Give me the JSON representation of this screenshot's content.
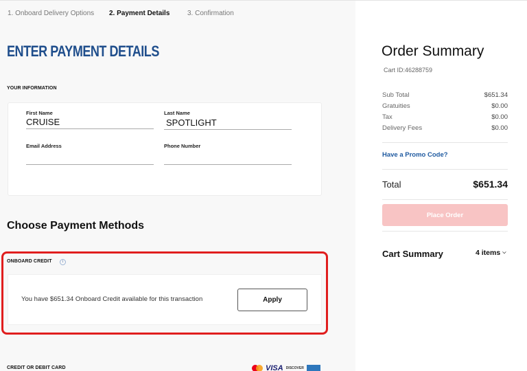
{
  "stepper": {
    "steps": [
      {
        "label": "1. Onboard Delivery Options",
        "active": false
      },
      {
        "label": "2. Payment Details",
        "active": true
      },
      {
        "label": "3. Confirmation",
        "active": false
      }
    ]
  },
  "page_title": "ENTER PAYMENT DETAILS",
  "your_information": {
    "label": "YOUR INFORMATION",
    "fields": {
      "first_name": {
        "label": "First Name",
        "value": "CRUISE"
      },
      "last_name": {
        "label": "Last Name",
        "value": "SPOTLIGHT"
      },
      "email": {
        "label": "Email Address",
        "value": ""
      },
      "phone": {
        "label": "Phone Number",
        "value": ""
      }
    }
  },
  "payment_methods": {
    "title": "Choose Payment Methods",
    "onboard_credit": {
      "label": "ONBOARD CREDIT",
      "info_icon": "info-icon",
      "message": "You have $651.34 Onboard Credit available for this transaction",
      "apply_label": "Apply"
    },
    "credit_card": {
      "label": "CREDIT OR DEBIT CARD",
      "card_logos": [
        "mastercard",
        "VISA",
        "DISCOVER",
        "amex"
      ]
    }
  },
  "order_summary": {
    "title": "Order Summary",
    "cart_id": "Cart ID:46288759",
    "rows": [
      {
        "label": "Sub Total",
        "value": "$651.34"
      },
      {
        "label": "Gratuities",
        "value": "$0.00"
      },
      {
        "label": "Tax",
        "value": "$0.00"
      },
      {
        "label": "Delivery Fees",
        "value": "$0.00"
      }
    ],
    "promo_link": "Have a Promo Code?",
    "total_label": "Total",
    "total_value": "$651.34",
    "place_order_label": "Place Order",
    "cart_summary_label": "Cart Summary",
    "items_count": "4 items",
    "chevron": "⌄"
  },
  "colors": {
    "brand_blue": "#1f4e8c",
    "highlight_red": "#e01e1e",
    "place_order_disabled": "#f8c4c4",
    "link_blue": "#1f5aa0"
  }
}
